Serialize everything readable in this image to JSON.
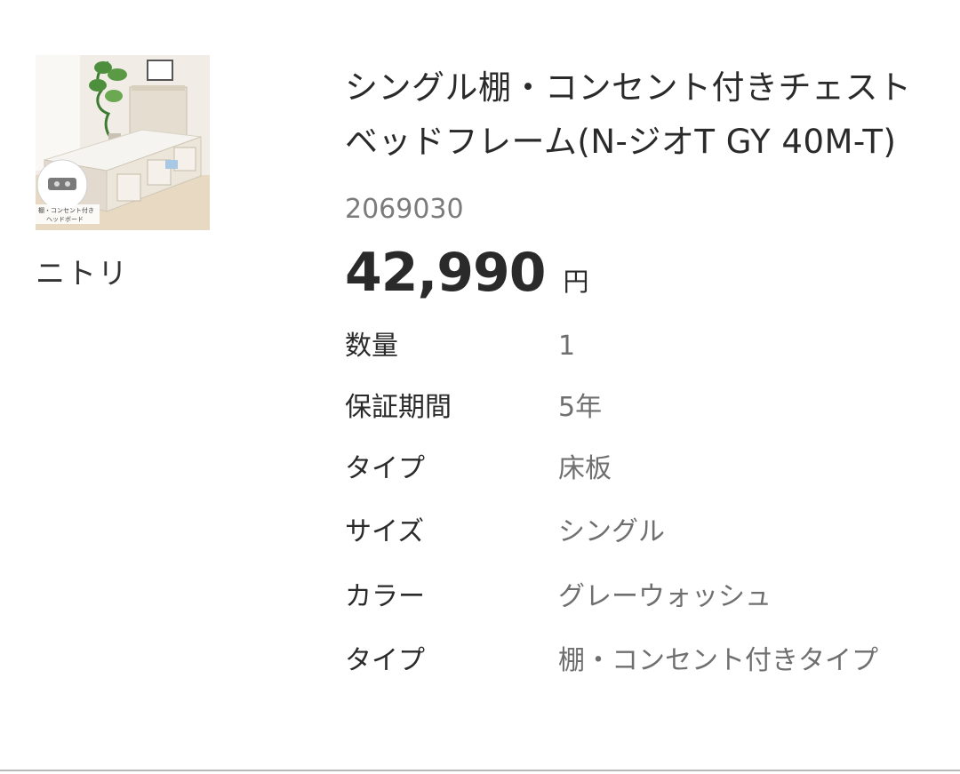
{
  "product": {
    "image_alt": "bed-frame-photo",
    "image_caption": "棚・コンセント付き ヘッドボード",
    "brand": "ニトリ",
    "title": "シングル棚・コンセント付きチェストベッドフレーム(N-ジオT GY 40M-T)",
    "code": "2069030",
    "price": "42,990",
    "currency": "円"
  },
  "specs": [
    {
      "label": "数量",
      "value": "1"
    },
    {
      "label": "保証期間",
      "value": "5年"
    },
    {
      "label": "タイプ",
      "value": "床板"
    },
    {
      "label": "サイズ",
      "value": "シングル"
    },
    {
      "label": "カラー",
      "value": "グレーウォッシュ"
    },
    {
      "label": "タイプ",
      "value": "棚・コンセント付きタイプ"
    }
  ]
}
